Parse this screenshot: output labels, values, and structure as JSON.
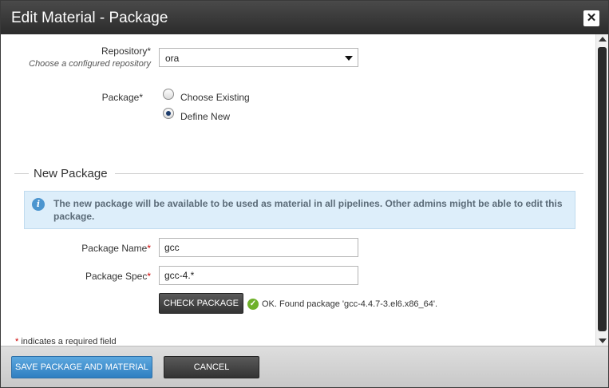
{
  "dialog": {
    "title": "Edit Material - Package",
    "close_label": "✕"
  },
  "repository": {
    "label": "Repository*",
    "hint": "Choose a configured repository",
    "selected": "ora"
  },
  "package": {
    "label": "Package*",
    "options": [
      {
        "label": "Choose Existing",
        "checked": false
      },
      {
        "label": "Define New",
        "checked": true
      }
    ]
  },
  "new_package": {
    "section_title": "New Package",
    "info_icon": "i",
    "info_text": "The new package will be available to be used as material in all pipelines. Other admins might be able to edit this package.",
    "name_label": "Package Name",
    "name_value": "gcc",
    "spec_label": "Package Spec",
    "spec_value": "gcc-4.*",
    "required_mark": "*",
    "check_button": "CHECK PACKAGE",
    "ok_icon": "✓",
    "check_result": "OK. Found package 'gcc-4.4.7-3.el6.x86_64'."
  },
  "required_note": {
    "mark": "*",
    "text": " indicates a required field"
  },
  "footer": {
    "save_label": "SAVE PACKAGE AND MATERIAL",
    "cancel_label": "CANCEL"
  },
  "colors": {
    "primary_button": "#2f7fc1",
    "info_background": "#ddeefa",
    "success": "#6fb12b",
    "required": "#cc0000"
  }
}
